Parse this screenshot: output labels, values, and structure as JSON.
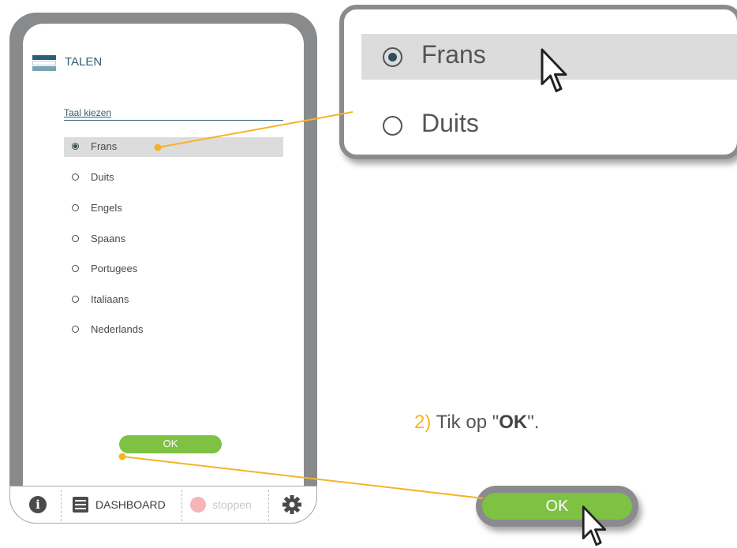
{
  "app": {
    "title": "TALEN",
    "section_title": "Taal kiezen",
    "languages": [
      {
        "label": "Frans",
        "selected": true
      },
      {
        "label": "Duits",
        "selected": false
      },
      {
        "label": "Engels",
        "selected": false
      },
      {
        "label": "Spaans",
        "selected": false
      },
      {
        "label": "Portugees",
        "selected": false
      },
      {
        "label": "Italiaans",
        "selected": false
      },
      {
        "label": "Nederlands",
        "selected": false
      }
    ],
    "ok_label": "OK",
    "bottom_bar": {
      "info_icon": "info-icon",
      "dashboard_label": "DASHBOARD",
      "stop_label": "stoppen",
      "settings_icon": "gear-icon"
    }
  },
  "callout": {
    "items": [
      {
        "label": "Frans",
        "selected": true
      },
      {
        "label": "Duits",
        "selected": false
      }
    ]
  },
  "instruction": {
    "step": "2)",
    "text_before": " Tik op \"",
    "bold": "OK",
    "text_after": "\"."
  },
  "big_button": {
    "label": "OK"
  },
  "colors": {
    "accent": "#2d5f74",
    "ok_green": "#7ec143",
    "connector": "#f5b32a",
    "frame_grey": "#898a8c",
    "selected_row": "#dcdcdc",
    "stop_red": "#f6b5b8"
  }
}
